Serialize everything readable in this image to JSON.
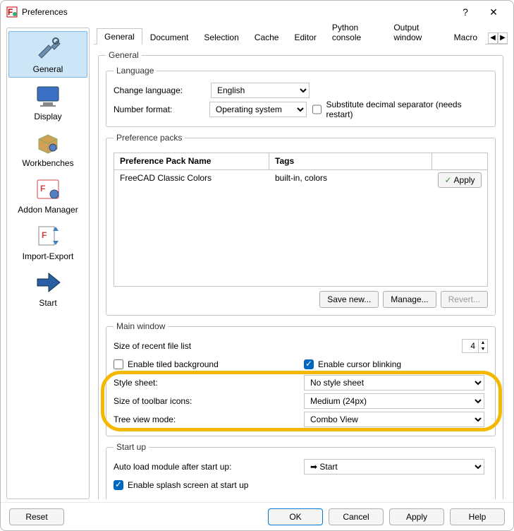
{
  "title": "Preferences",
  "nav": [
    {
      "label": "General"
    },
    {
      "label": "Display"
    },
    {
      "label": "Workbenches"
    },
    {
      "label": "Addon Manager"
    },
    {
      "label": "Import-Export"
    },
    {
      "label": "Start"
    }
  ],
  "tabs": [
    "General",
    "Document",
    "Selection",
    "Cache",
    "Editor",
    "Python console",
    "Output window",
    "Macro"
  ],
  "general": {
    "legend": "General",
    "language": {
      "legend": "Language",
      "change_label": "Change language:",
      "change_value": "English",
      "format_label": "Number format:",
      "format_value": "Operating system",
      "decimal_label": "Substitute decimal separator (needs restart)"
    },
    "packs": {
      "legend": "Preference packs",
      "col_name": "Preference Pack Name",
      "col_tags": "Tags",
      "row_name": "FreeCAD Classic Colors",
      "row_tags": "built-in, colors",
      "apply": "Apply",
      "save": "Save new...",
      "manage": "Manage...",
      "revert": "Revert..."
    },
    "mainwin": {
      "legend": "Main window",
      "recent_label": "Size of recent file list",
      "recent_value": "4",
      "tiled_label": "Enable tiled background",
      "cursor_label": "Enable cursor blinking",
      "style_label": "Style sheet:",
      "style_value": "No style sheet",
      "icons_label": "Size of toolbar icons:",
      "icons_value": "Medium (24px)",
      "tree_label": "Tree view mode:",
      "tree_value": "Combo View"
    },
    "startup": {
      "legend": "Start up",
      "autoload_label": "Auto load module after start up:",
      "autoload_value": "Start",
      "splash_label": "Enable splash screen at start up"
    }
  },
  "footer": {
    "reset": "Reset",
    "ok": "OK",
    "cancel": "Cancel",
    "apply": "Apply",
    "help": "Help"
  }
}
